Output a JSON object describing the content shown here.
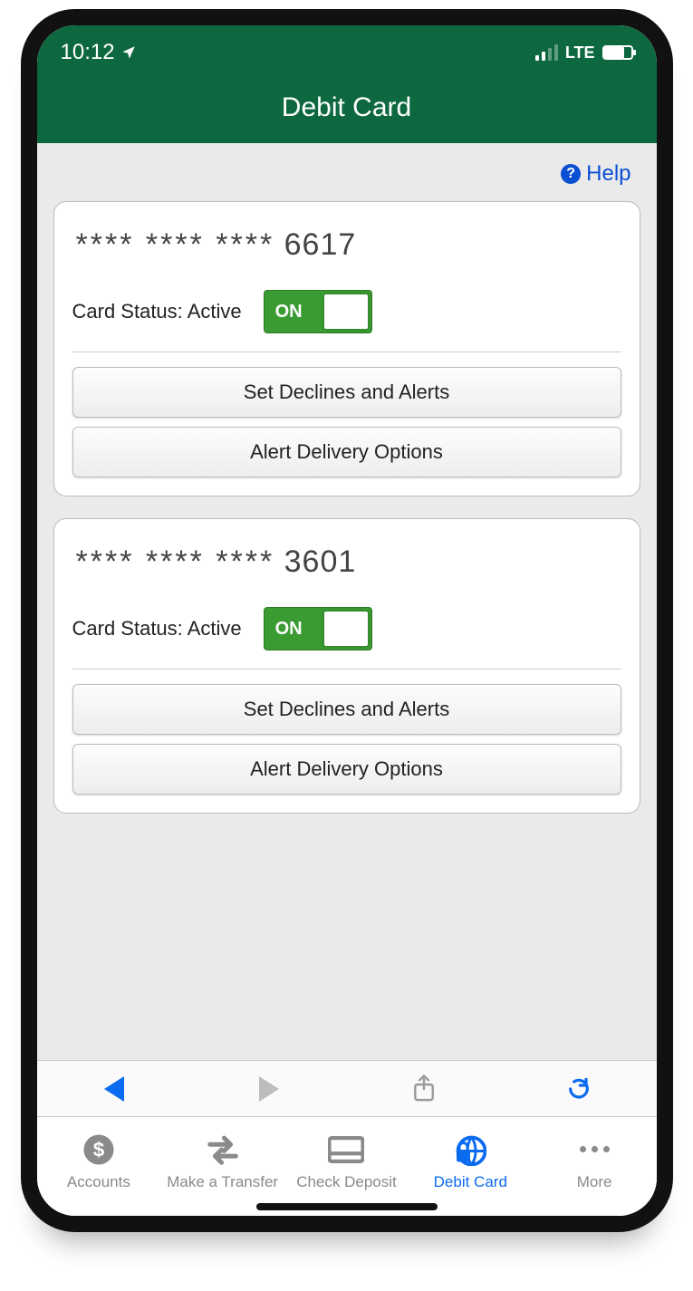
{
  "status": {
    "time": "10:12",
    "network_label": "LTE"
  },
  "header": {
    "title": "Debit Card"
  },
  "help": {
    "label": "Help"
  },
  "cards": [
    {
      "masked": "**** **** ****",
      "last4": "6617",
      "status_label": "Card Status:",
      "status_value": "Active",
      "toggle_label": "ON",
      "declines_btn": "Set Declines and Alerts",
      "delivery_btn": "Alert Delivery Options"
    },
    {
      "masked": "**** **** ****",
      "last4": "3601",
      "status_label": "Card Status:",
      "status_value": "Active",
      "toggle_label": "ON",
      "declines_btn": "Set Declines and Alerts",
      "delivery_btn": "Alert Delivery Options"
    }
  ],
  "tabs": {
    "accounts": "Accounts",
    "transfer": "Make a Transfer",
    "deposit": "Check Deposit",
    "debit": "Debit Card",
    "more": "More"
  },
  "colors": {
    "brand_green": "#0d6840",
    "toggle_green": "#3a9b32",
    "ios_blue": "#0b6bf0",
    "link_blue": "#0b4fd3"
  }
}
